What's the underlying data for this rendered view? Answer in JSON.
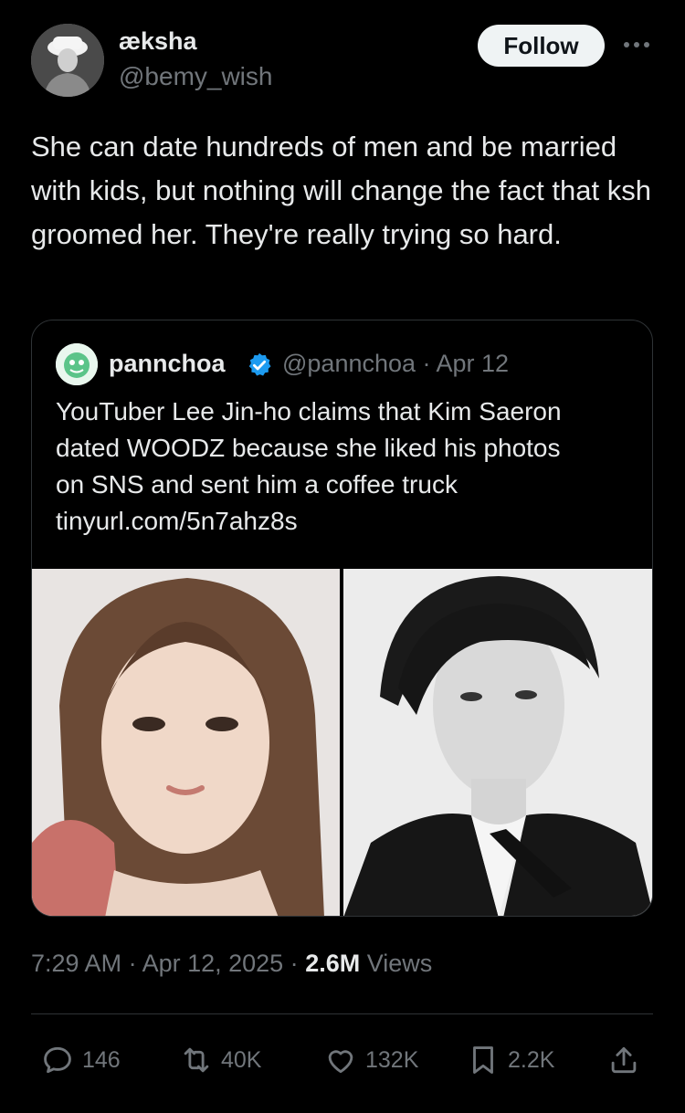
{
  "author": {
    "display_name": "æksha",
    "handle": "@bemy_wish",
    "follow_label": "Follow",
    "more_icon": "more-horizontal-icon"
  },
  "tweet": {
    "text": "She can date hundreds of men and be married with kids, but nothing will change the fact that ksh groomed her. They're really trying so hard."
  },
  "quote": {
    "name": "pannchoa",
    "handle_date": "@pannchoa · Apr 12",
    "text_line1": "YouTuber Lee Jin-ho claims that Kim Saeron",
    "text_line2": "dated WOODZ because she liked his photos",
    "text_line3": "on SNS and sent him a coffee truck",
    "link": "tinyurl.com/5n7ahz8s",
    "verified_color": "#1d9bf0"
  },
  "meta": {
    "time_date": "7:29 AM · Apr 12, 2025 · ",
    "views_count": "2.6M",
    "views_label": " Views"
  },
  "actions": {
    "replies": "146",
    "reposts": "40K",
    "likes": "132K",
    "bookmarks": "2.2K"
  },
  "colors": {
    "background": "#000000",
    "text": "#e7e9ea",
    "muted": "#71767b",
    "border": "#2f3336"
  }
}
